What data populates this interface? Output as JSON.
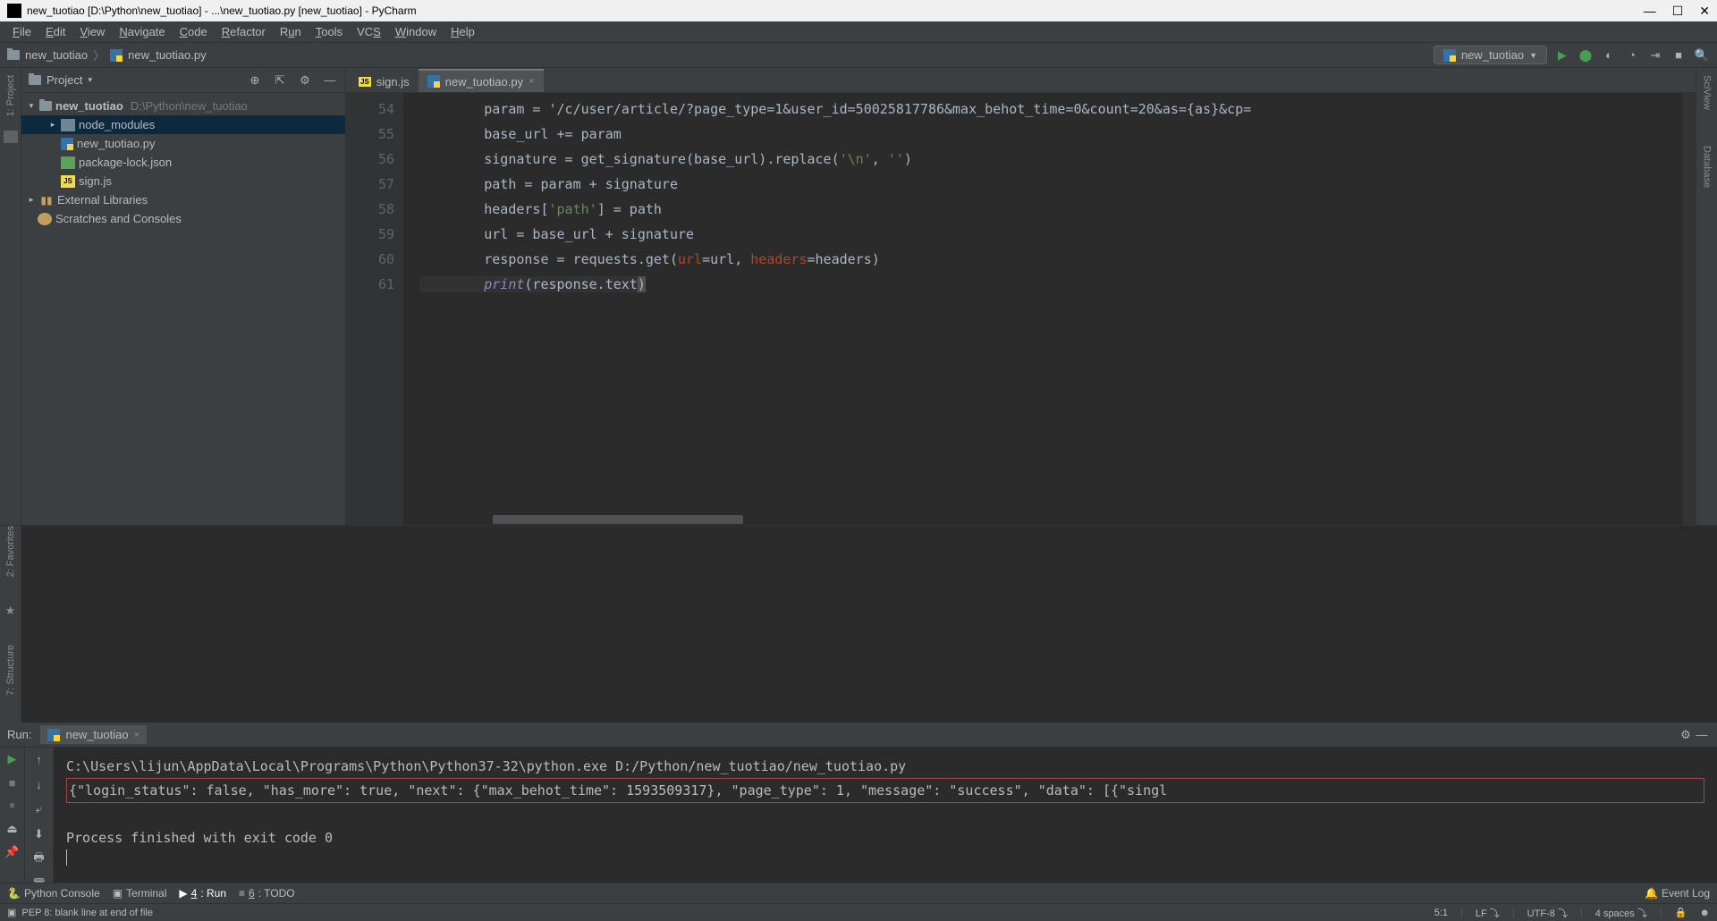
{
  "titlebar": {
    "text": "new_tuotiao [D:\\Python\\new_tuotiao] - ...\\new_tuotiao.py [new_tuotiao] - PyCharm"
  },
  "menu": [
    "File",
    "Edit",
    "View",
    "Navigate",
    "Code",
    "Refactor",
    "Run",
    "Tools",
    "VCS",
    "Window",
    "Help"
  ],
  "breadcrumb": {
    "root": "new_tuotiao",
    "file": "new_tuotiao.py"
  },
  "run_config": "new_tuotiao",
  "project_panel": {
    "title": "Project",
    "tree": {
      "root": {
        "name": "new_tuotiao",
        "path": "D:\\Python\\new_tuotiao"
      },
      "items": [
        {
          "name": "node_modules",
          "kind": "folder",
          "selected": true
        },
        {
          "name": "new_tuotiao.py",
          "kind": "py"
        },
        {
          "name": "package-lock.json",
          "kind": "json"
        },
        {
          "name": "sign.js",
          "kind": "js"
        }
      ],
      "external": "External Libraries",
      "scratches": "Scratches and Consoles"
    }
  },
  "editor_tabs": [
    {
      "name": "sign.js",
      "kind": "js",
      "active": false
    },
    {
      "name": "new_tuotiao.py",
      "kind": "py",
      "active": true
    }
  ],
  "code_lines": {
    "start": 54,
    "lines": [
      "        param = '/c/user/article/?page_type=1&user_id=50025817786&max_behot_time=0&count=20&as={as}&cp=",
      "        base_url += param",
      "        signature = get_signature(base_url).replace('\\n', '')",
      "        path = param + signature",
      "        headers['path'] = path",
      "        url = base_url + signature",
      "        response = requests.get(url=url, headers=headers)",
      "        print(response.text)"
    ]
  },
  "run_panel": {
    "label": "Run:",
    "tab": "new_tuotiao",
    "output": {
      "cmd": "C:\\Users\\lijun\\AppData\\Local\\Programs\\Python\\Python37-32\\python.exe D:/Python/new_tuotiao/new_tuotiao.py",
      "result": "{\"login_status\": false, \"has_more\": true, \"next\": {\"max_behot_time\": 1593509317}, \"page_type\": 1, \"message\": \"success\", \"data\": [{\"singl",
      "exit": "Process finished with exit code 0"
    }
  },
  "left_tools": {
    "project": "1: Project"
  },
  "left_strip": {
    "fav": "2: Favorites",
    "struct": "7: Structure"
  },
  "right_tools": {
    "sci": "SciView",
    "db": "Database"
  },
  "bottom_bar": {
    "python_console": "Python Console",
    "terminal": "Terminal",
    "run": "4: Run",
    "todo": "6: TODO",
    "event_log": "Event Log"
  },
  "statusbar": {
    "msg": "PEP 8: blank line at end of file",
    "pos": "5:1",
    "lf": "LF",
    "enc": "UTF-8",
    "indent": "4 spaces"
  }
}
